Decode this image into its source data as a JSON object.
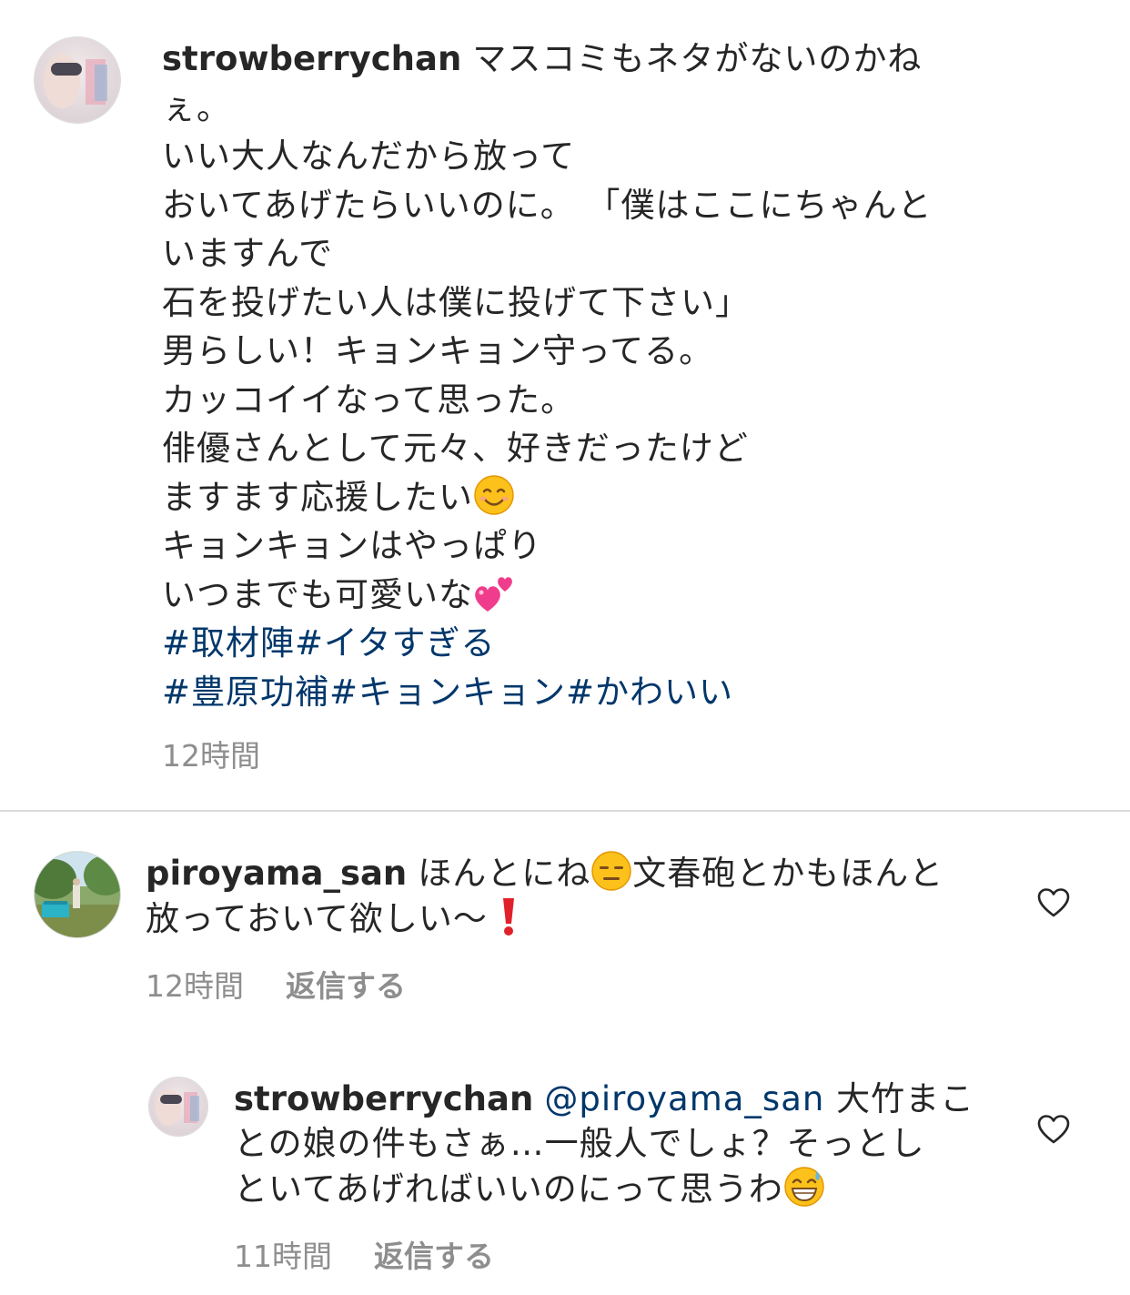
{
  "caption": {
    "username": "strowberrychan",
    "lines": [
      "マスコミもネタがないのかね",
      "ぇ。",
      "いい大人なんだから放って",
      "おいてあげたらいいのに。 「僕はここにちゃんと",
      "いますんで",
      "石を投げたい人は僕に投げて下さい」",
      "男らしい！キョンキョン守ってる。",
      "カッコイイなって思った。",
      "俳優さんとして元々、好きだったけど",
      "ますます応援したい",
      "キョンキョンはやっぱり",
      "いつまでも可愛いな"
    ],
    "hashtags": [
      "#取材陣#イタすぎる",
      "#豊原功補#キョンキョン#かわいい"
    ],
    "time": "12時間",
    "emoji_line10": "smiling-face-emoji",
    "emoji_line12": "two-hearts-emoji"
  },
  "comments": [
    {
      "username": "piroyama_san",
      "text_part1": "ほんとにね",
      "text_part2": "文春砲とかもほんと",
      "line2": "放っておいて欲しい〜",
      "time": "12時間",
      "reply_label": "返信する",
      "emoji1": "expressionless-face-emoji",
      "emoji2": "red-exclamation-emoji"
    },
    {
      "username": "strowberrychan",
      "mention": "@piroyama_san",
      "text_part1": "大竹まこ",
      "line2": "との娘の件もさぁ…一般人でしょ？そっとし",
      "line3": "といてあげればいいのにって思うわ",
      "time": "11時間",
      "reply_label": "返信する",
      "emoji": "grinning-sweat-emoji"
    }
  ],
  "colors": {
    "text": "#262626",
    "link": "#00376b",
    "meta": "#8e8e8e",
    "divider": "#dbdbdb"
  }
}
